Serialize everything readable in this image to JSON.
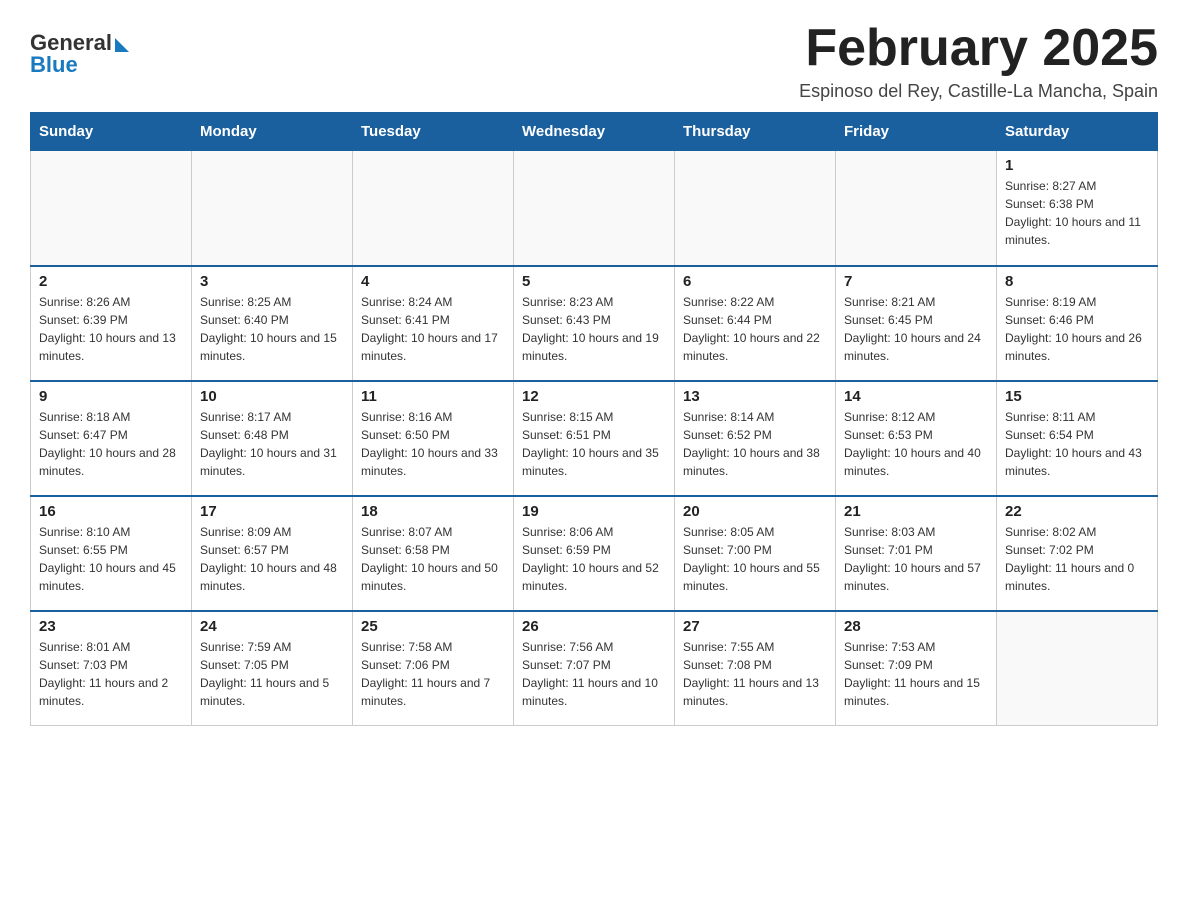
{
  "header": {
    "logo": {
      "general": "General",
      "blue": "Blue"
    },
    "title": "February 2025",
    "subtitle": "Espinoso del Rey, Castille-La Mancha, Spain"
  },
  "weekdays": [
    "Sunday",
    "Monday",
    "Tuesday",
    "Wednesday",
    "Thursday",
    "Friday",
    "Saturday"
  ],
  "weeks": [
    [
      {
        "day": "",
        "sunrise": "",
        "sunset": "",
        "daylight": ""
      },
      {
        "day": "",
        "sunrise": "",
        "sunset": "",
        "daylight": ""
      },
      {
        "day": "",
        "sunrise": "",
        "sunset": "",
        "daylight": ""
      },
      {
        "day": "",
        "sunrise": "",
        "sunset": "",
        "daylight": ""
      },
      {
        "day": "",
        "sunrise": "",
        "sunset": "",
        "daylight": ""
      },
      {
        "day": "",
        "sunrise": "",
        "sunset": "",
        "daylight": ""
      },
      {
        "day": "1",
        "sunrise": "Sunrise: 8:27 AM",
        "sunset": "Sunset: 6:38 PM",
        "daylight": "Daylight: 10 hours and 11 minutes."
      }
    ],
    [
      {
        "day": "2",
        "sunrise": "Sunrise: 8:26 AM",
        "sunset": "Sunset: 6:39 PM",
        "daylight": "Daylight: 10 hours and 13 minutes."
      },
      {
        "day": "3",
        "sunrise": "Sunrise: 8:25 AM",
        "sunset": "Sunset: 6:40 PM",
        "daylight": "Daylight: 10 hours and 15 minutes."
      },
      {
        "day": "4",
        "sunrise": "Sunrise: 8:24 AM",
        "sunset": "Sunset: 6:41 PM",
        "daylight": "Daylight: 10 hours and 17 minutes."
      },
      {
        "day": "5",
        "sunrise": "Sunrise: 8:23 AM",
        "sunset": "Sunset: 6:43 PM",
        "daylight": "Daylight: 10 hours and 19 minutes."
      },
      {
        "day": "6",
        "sunrise": "Sunrise: 8:22 AM",
        "sunset": "Sunset: 6:44 PM",
        "daylight": "Daylight: 10 hours and 22 minutes."
      },
      {
        "day": "7",
        "sunrise": "Sunrise: 8:21 AM",
        "sunset": "Sunset: 6:45 PM",
        "daylight": "Daylight: 10 hours and 24 minutes."
      },
      {
        "day": "8",
        "sunrise": "Sunrise: 8:19 AM",
        "sunset": "Sunset: 6:46 PM",
        "daylight": "Daylight: 10 hours and 26 minutes."
      }
    ],
    [
      {
        "day": "9",
        "sunrise": "Sunrise: 8:18 AM",
        "sunset": "Sunset: 6:47 PM",
        "daylight": "Daylight: 10 hours and 28 minutes."
      },
      {
        "day": "10",
        "sunrise": "Sunrise: 8:17 AM",
        "sunset": "Sunset: 6:48 PM",
        "daylight": "Daylight: 10 hours and 31 minutes."
      },
      {
        "day": "11",
        "sunrise": "Sunrise: 8:16 AM",
        "sunset": "Sunset: 6:50 PM",
        "daylight": "Daylight: 10 hours and 33 minutes."
      },
      {
        "day": "12",
        "sunrise": "Sunrise: 8:15 AM",
        "sunset": "Sunset: 6:51 PM",
        "daylight": "Daylight: 10 hours and 35 minutes."
      },
      {
        "day": "13",
        "sunrise": "Sunrise: 8:14 AM",
        "sunset": "Sunset: 6:52 PM",
        "daylight": "Daylight: 10 hours and 38 minutes."
      },
      {
        "day": "14",
        "sunrise": "Sunrise: 8:12 AM",
        "sunset": "Sunset: 6:53 PM",
        "daylight": "Daylight: 10 hours and 40 minutes."
      },
      {
        "day": "15",
        "sunrise": "Sunrise: 8:11 AM",
        "sunset": "Sunset: 6:54 PM",
        "daylight": "Daylight: 10 hours and 43 minutes."
      }
    ],
    [
      {
        "day": "16",
        "sunrise": "Sunrise: 8:10 AM",
        "sunset": "Sunset: 6:55 PM",
        "daylight": "Daylight: 10 hours and 45 minutes."
      },
      {
        "day": "17",
        "sunrise": "Sunrise: 8:09 AM",
        "sunset": "Sunset: 6:57 PM",
        "daylight": "Daylight: 10 hours and 48 minutes."
      },
      {
        "day": "18",
        "sunrise": "Sunrise: 8:07 AM",
        "sunset": "Sunset: 6:58 PM",
        "daylight": "Daylight: 10 hours and 50 minutes."
      },
      {
        "day": "19",
        "sunrise": "Sunrise: 8:06 AM",
        "sunset": "Sunset: 6:59 PM",
        "daylight": "Daylight: 10 hours and 52 minutes."
      },
      {
        "day": "20",
        "sunrise": "Sunrise: 8:05 AM",
        "sunset": "Sunset: 7:00 PM",
        "daylight": "Daylight: 10 hours and 55 minutes."
      },
      {
        "day": "21",
        "sunrise": "Sunrise: 8:03 AM",
        "sunset": "Sunset: 7:01 PM",
        "daylight": "Daylight: 10 hours and 57 minutes."
      },
      {
        "day": "22",
        "sunrise": "Sunrise: 8:02 AM",
        "sunset": "Sunset: 7:02 PM",
        "daylight": "Daylight: 11 hours and 0 minutes."
      }
    ],
    [
      {
        "day": "23",
        "sunrise": "Sunrise: 8:01 AM",
        "sunset": "Sunset: 7:03 PM",
        "daylight": "Daylight: 11 hours and 2 minutes."
      },
      {
        "day": "24",
        "sunrise": "Sunrise: 7:59 AM",
        "sunset": "Sunset: 7:05 PM",
        "daylight": "Daylight: 11 hours and 5 minutes."
      },
      {
        "day": "25",
        "sunrise": "Sunrise: 7:58 AM",
        "sunset": "Sunset: 7:06 PM",
        "daylight": "Daylight: 11 hours and 7 minutes."
      },
      {
        "day": "26",
        "sunrise": "Sunrise: 7:56 AM",
        "sunset": "Sunset: 7:07 PM",
        "daylight": "Daylight: 11 hours and 10 minutes."
      },
      {
        "day": "27",
        "sunrise": "Sunrise: 7:55 AM",
        "sunset": "Sunset: 7:08 PM",
        "daylight": "Daylight: 11 hours and 13 minutes."
      },
      {
        "day": "28",
        "sunrise": "Sunrise: 7:53 AM",
        "sunset": "Sunset: 7:09 PM",
        "daylight": "Daylight: 11 hours and 15 minutes."
      },
      {
        "day": "",
        "sunrise": "",
        "sunset": "",
        "daylight": ""
      }
    ]
  ]
}
